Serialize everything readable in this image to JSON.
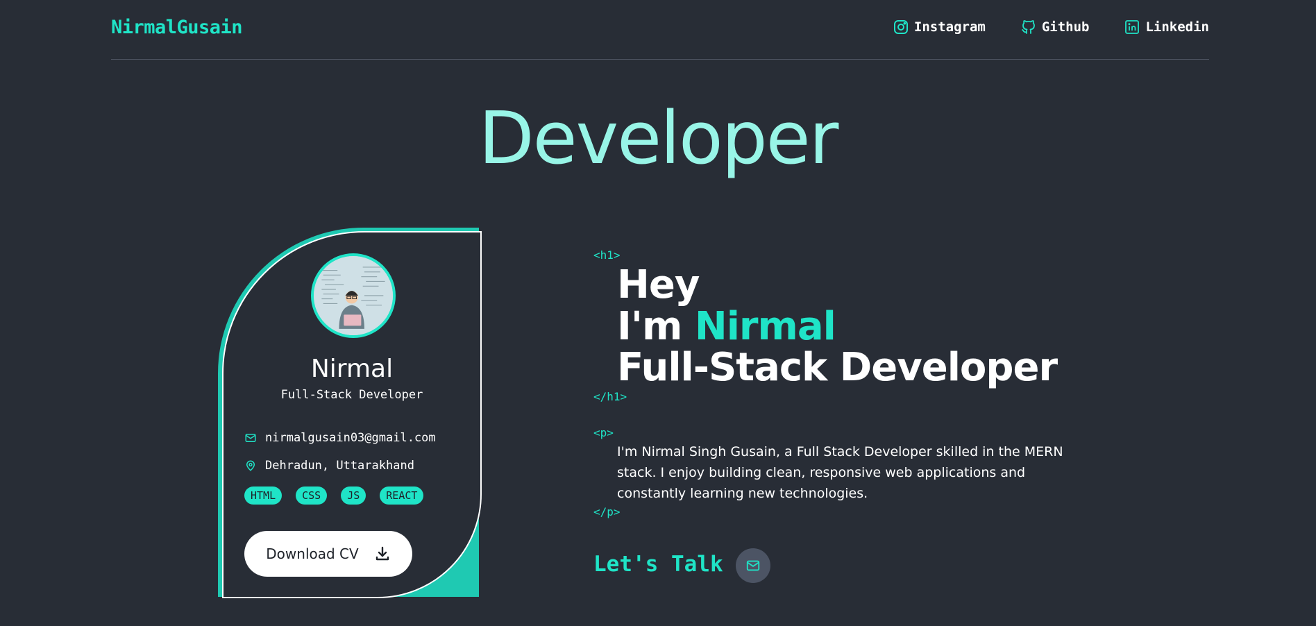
{
  "header": {
    "logo": "NirmalGusain",
    "nav": [
      {
        "label": "Instagram",
        "icon": "instagram-icon"
      },
      {
        "label": "Github",
        "icon": "github-icon"
      },
      {
        "label": "Linkedin",
        "icon": "linkedin-icon"
      }
    ]
  },
  "hero": {
    "title": "Developer"
  },
  "card": {
    "name": "Nirmal",
    "role": "Full-Stack Developer",
    "email": "nirmalgusain03@gmail.com",
    "location": "Dehradun, Uttarakhand",
    "tags": [
      "HTML",
      "CSS",
      "JS",
      "REACT"
    ],
    "download_label": "Download CV"
  },
  "intro": {
    "h1_open": "<h1>",
    "h1_close": "</h1>",
    "line1": "Hey",
    "line2_prefix": "I'm ",
    "line2_name": "Nirmal",
    "line3": "Full-Stack Developer",
    "p_open": "<p>",
    "p_close": "</p>",
    "about": "I'm Nirmal Singh Gusain, a Full Stack Developer skilled in the MERN stack. I enjoy building clean, responsive web applications and constantly learning new technologies.",
    "lets_talk": "Let's Talk"
  },
  "colors": {
    "background": "#282d36",
    "accent": "#1fe4c7",
    "title": "#98f5e7"
  }
}
